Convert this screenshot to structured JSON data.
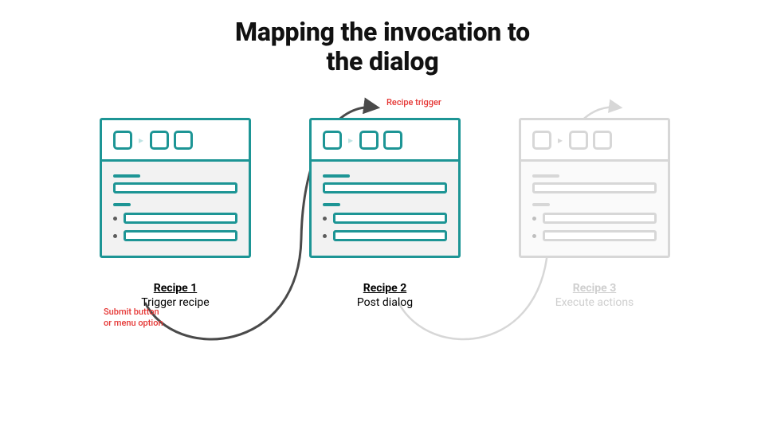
{
  "title": {
    "line1": "Mapping the invocation to",
    "line2": "the dialog"
  },
  "annotations": {
    "submit": "Submit button\nor menu option",
    "trigger": "Recipe trigger"
  },
  "cards": [
    {
      "name": "Recipe 1",
      "desc": "Trigger recipe",
      "faded": false
    },
    {
      "name": "Recipe 2",
      "desc": "Post dialog",
      "faded": false
    },
    {
      "name": "Recipe 3",
      "desc": "Execute actions",
      "faded": true
    }
  ],
  "colors": {
    "teal": "#1d9595",
    "tealIcon": "#bfe3e3",
    "grayStroke": "#d7d7d7",
    "grayIcon": "#d7d7d7",
    "dotDark": "#5c5c5c",
    "dotLight": "#bfbfbf",
    "arrowDark": "#4a4a4a",
    "arrowLight": "#d7d7d7"
  },
  "chart_data": {
    "type": "diagram",
    "title": "Mapping the invocation to the dialog",
    "nodes": [
      {
        "id": "recipe1",
        "label": "Recipe 1",
        "subtitle": "Trigger recipe",
        "state": "active"
      },
      {
        "id": "recipe2",
        "label": "Recipe 2",
        "subtitle": "Post dialog",
        "state": "active"
      },
      {
        "id": "recipe3",
        "label": "Recipe 3",
        "subtitle": "Execute actions",
        "state": "inactive"
      }
    ],
    "edges": [
      {
        "from": "recipe1",
        "to": "recipe2",
        "label_from": "Submit button or menu option",
        "label_to": "Recipe trigger",
        "state": "active"
      },
      {
        "from": "recipe2",
        "to": "recipe3",
        "state": "inactive"
      }
    ]
  }
}
